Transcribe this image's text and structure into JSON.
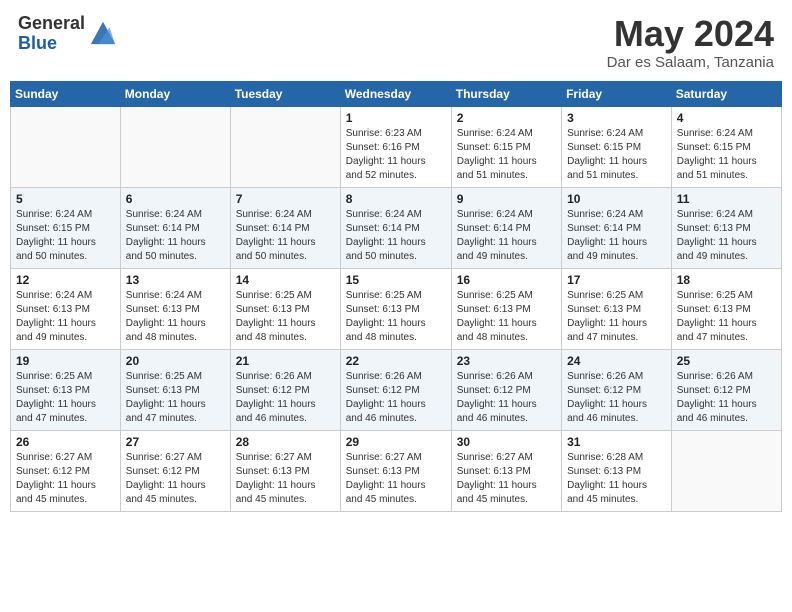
{
  "header": {
    "logo_general": "General",
    "logo_blue": "Blue",
    "month_title": "May 2024",
    "subtitle": "Dar es Salaam, Tanzania"
  },
  "calendar": {
    "days_of_week": [
      "Sunday",
      "Monday",
      "Tuesday",
      "Wednesday",
      "Thursday",
      "Friday",
      "Saturday"
    ],
    "weeks": [
      [
        {
          "day": "",
          "info": ""
        },
        {
          "day": "",
          "info": ""
        },
        {
          "day": "",
          "info": ""
        },
        {
          "day": "1",
          "info": "Sunrise: 6:23 AM\nSunset: 6:16 PM\nDaylight: 11 hours\nand 52 minutes."
        },
        {
          "day": "2",
          "info": "Sunrise: 6:24 AM\nSunset: 6:15 PM\nDaylight: 11 hours\nand 51 minutes."
        },
        {
          "day": "3",
          "info": "Sunrise: 6:24 AM\nSunset: 6:15 PM\nDaylight: 11 hours\nand 51 minutes."
        },
        {
          "day": "4",
          "info": "Sunrise: 6:24 AM\nSunset: 6:15 PM\nDaylight: 11 hours\nand 51 minutes."
        }
      ],
      [
        {
          "day": "5",
          "info": "Sunrise: 6:24 AM\nSunset: 6:15 PM\nDaylight: 11 hours\nand 50 minutes."
        },
        {
          "day": "6",
          "info": "Sunrise: 6:24 AM\nSunset: 6:14 PM\nDaylight: 11 hours\nand 50 minutes."
        },
        {
          "day": "7",
          "info": "Sunrise: 6:24 AM\nSunset: 6:14 PM\nDaylight: 11 hours\nand 50 minutes."
        },
        {
          "day": "8",
          "info": "Sunrise: 6:24 AM\nSunset: 6:14 PM\nDaylight: 11 hours\nand 50 minutes."
        },
        {
          "day": "9",
          "info": "Sunrise: 6:24 AM\nSunset: 6:14 PM\nDaylight: 11 hours\nand 49 minutes."
        },
        {
          "day": "10",
          "info": "Sunrise: 6:24 AM\nSunset: 6:14 PM\nDaylight: 11 hours\nand 49 minutes."
        },
        {
          "day": "11",
          "info": "Sunrise: 6:24 AM\nSunset: 6:13 PM\nDaylight: 11 hours\nand 49 minutes."
        }
      ],
      [
        {
          "day": "12",
          "info": "Sunrise: 6:24 AM\nSunset: 6:13 PM\nDaylight: 11 hours\nand 49 minutes."
        },
        {
          "day": "13",
          "info": "Sunrise: 6:24 AM\nSunset: 6:13 PM\nDaylight: 11 hours\nand 48 minutes."
        },
        {
          "day": "14",
          "info": "Sunrise: 6:25 AM\nSunset: 6:13 PM\nDaylight: 11 hours\nand 48 minutes."
        },
        {
          "day": "15",
          "info": "Sunrise: 6:25 AM\nSunset: 6:13 PM\nDaylight: 11 hours\nand 48 minutes."
        },
        {
          "day": "16",
          "info": "Sunrise: 6:25 AM\nSunset: 6:13 PM\nDaylight: 11 hours\nand 48 minutes."
        },
        {
          "day": "17",
          "info": "Sunrise: 6:25 AM\nSunset: 6:13 PM\nDaylight: 11 hours\nand 47 minutes."
        },
        {
          "day": "18",
          "info": "Sunrise: 6:25 AM\nSunset: 6:13 PM\nDaylight: 11 hours\nand 47 minutes."
        }
      ],
      [
        {
          "day": "19",
          "info": "Sunrise: 6:25 AM\nSunset: 6:13 PM\nDaylight: 11 hours\nand 47 minutes."
        },
        {
          "day": "20",
          "info": "Sunrise: 6:25 AM\nSunset: 6:13 PM\nDaylight: 11 hours\nand 47 minutes."
        },
        {
          "day": "21",
          "info": "Sunrise: 6:26 AM\nSunset: 6:12 PM\nDaylight: 11 hours\nand 46 minutes."
        },
        {
          "day": "22",
          "info": "Sunrise: 6:26 AM\nSunset: 6:12 PM\nDaylight: 11 hours\nand 46 minutes."
        },
        {
          "day": "23",
          "info": "Sunrise: 6:26 AM\nSunset: 6:12 PM\nDaylight: 11 hours\nand 46 minutes."
        },
        {
          "day": "24",
          "info": "Sunrise: 6:26 AM\nSunset: 6:12 PM\nDaylight: 11 hours\nand 46 minutes."
        },
        {
          "day": "25",
          "info": "Sunrise: 6:26 AM\nSunset: 6:12 PM\nDaylight: 11 hours\nand 46 minutes."
        }
      ],
      [
        {
          "day": "26",
          "info": "Sunrise: 6:27 AM\nSunset: 6:12 PM\nDaylight: 11 hours\nand 45 minutes."
        },
        {
          "day": "27",
          "info": "Sunrise: 6:27 AM\nSunset: 6:12 PM\nDaylight: 11 hours\nand 45 minutes."
        },
        {
          "day": "28",
          "info": "Sunrise: 6:27 AM\nSunset: 6:13 PM\nDaylight: 11 hours\nand 45 minutes."
        },
        {
          "day": "29",
          "info": "Sunrise: 6:27 AM\nSunset: 6:13 PM\nDaylight: 11 hours\nand 45 minutes."
        },
        {
          "day": "30",
          "info": "Sunrise: 6:27 AM\nSunset: 6:13 PM\nDaylight: 11 hours\nand 45 minutes."
        },
        {
          "day": "31",
          "info": "Sunrise: 6:28 AM\nSunset: 6:13 PM\nDaylight: 11 hours\nand 45 minutes."
        },
        {
          "day": "",
          "info": ""
        }
      ]
    ]
  }
}
